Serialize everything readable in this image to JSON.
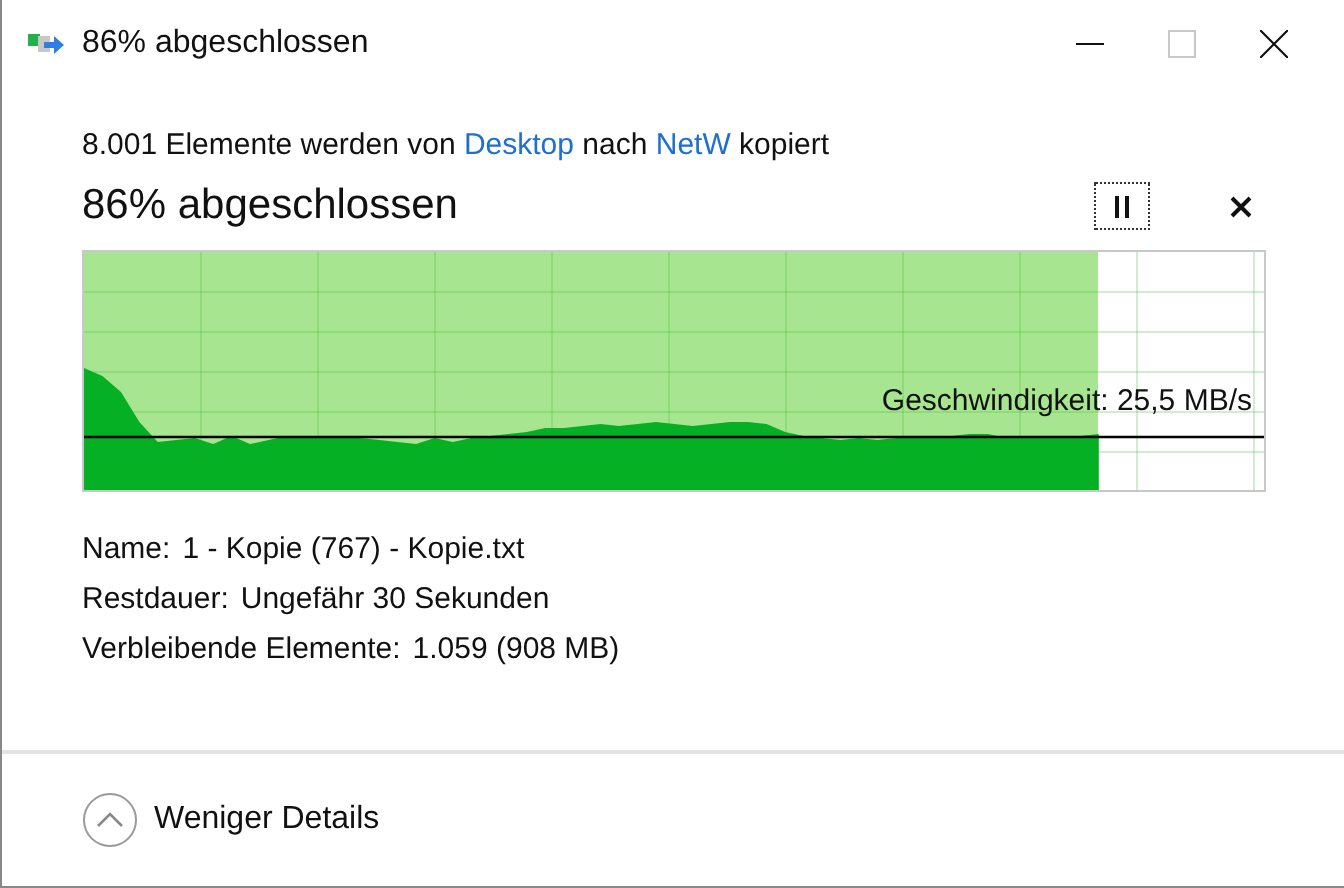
{
  "window": {
    "title": "86% abgeschlossen"
  },
  "description": [
    {
      "kind": "text",
      "text": "8.001 Elemente werden von "
    },
    {
      "kind": "link",
      "text": "Desktop"
    },
    {
      "kind": "text",
      "text": " nach "
    },
    {
      "kind": "link",
      "text": "NetW"
    },
    {
      "kind": "text",
      "text": " kopiert"
    }
  ],
  "heading": "86% abgeschlossen",
  "progress": {
    "level": 0.86,
    "speed": "Geschwindigkeit: 25,5 MB/s"
  },
  "details": [
    {
      "label": "Name:",
      "value": "1 - Kopie (767) - Kopie.txt"
    },
    {
      "label": "Restdauer:",
      "value": "Ungefähr 30 Sekunden"
    },
    {
      "label": "Verbleibende Elemente:",
      "value": "1.059 (908 MB)"
    }
  ],
  "footer": {
    "label": "Weniger Details",
    "expanded": true
  }
}
